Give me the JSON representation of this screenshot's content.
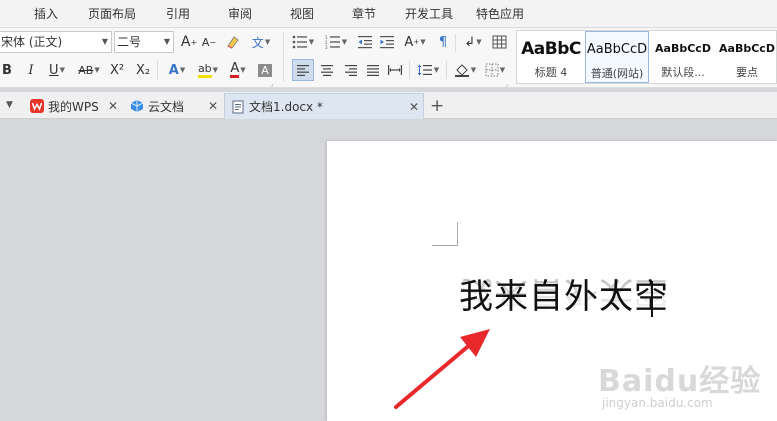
{
  "menu": {
    "tabs": [
      "插入",
      "页面布局",
      "引用",
      "审阅",
      "视图",
      "章节",
      "开发工具",
      "特色应用"
    ]
  },
  "ribbon": {
    "font_name": "宋体 (正文)",
    "font_size": "二号",
    "buttons": {
      "grow_font": "A⁺",
      "shrink_font": "A⁻",
      "bold": "B",
      "italic": "I",
      "underline": "U",
      "strikethrough": "AB",
      "superscript": "X²",
      "subscript": "X₂",
      "text_effect": "A",
      "highlight": "ab",
      "font_color": "A",
      "char_shading": "A",
      "phonetic": "文"
    },
    "styles": [
      {
        "sample": "AaBbC",
        "label": "标题 4"
      },
      {
        "sample": "AaBbCcD",
        "label": "普通(网站)"
      },
      {
        "sample": "AaBbCcD",
        "label": "默认段..."
      },
      {
        "sample": "AaBbCcD",
        "label": "要点"
      }
    ],
    "colors": {
      "highlight": "#f1e000",
      "font_color": "#d9211f",
      "accent": "#3b73c9"
    }
  },
  "doc_tabs": {
    "items": [
      {
        "label": "我的WPS",
        "icon": "wps-logo-icon"
      },
      {
        "label": "云文档",
        "icon": "cloud-doc-icon"
      },
      {
        "label": "文档1.docx *",
        "icon": "document-icon",
        "active": true
      }
    ],
    "new_tab": "+"
  },
  "document": {
    "text": "我来自外太空"
  },
  "watermark": {
    "main": "Baidu经验",
    "sub": "jingyan.baidu.com"
  }
}
